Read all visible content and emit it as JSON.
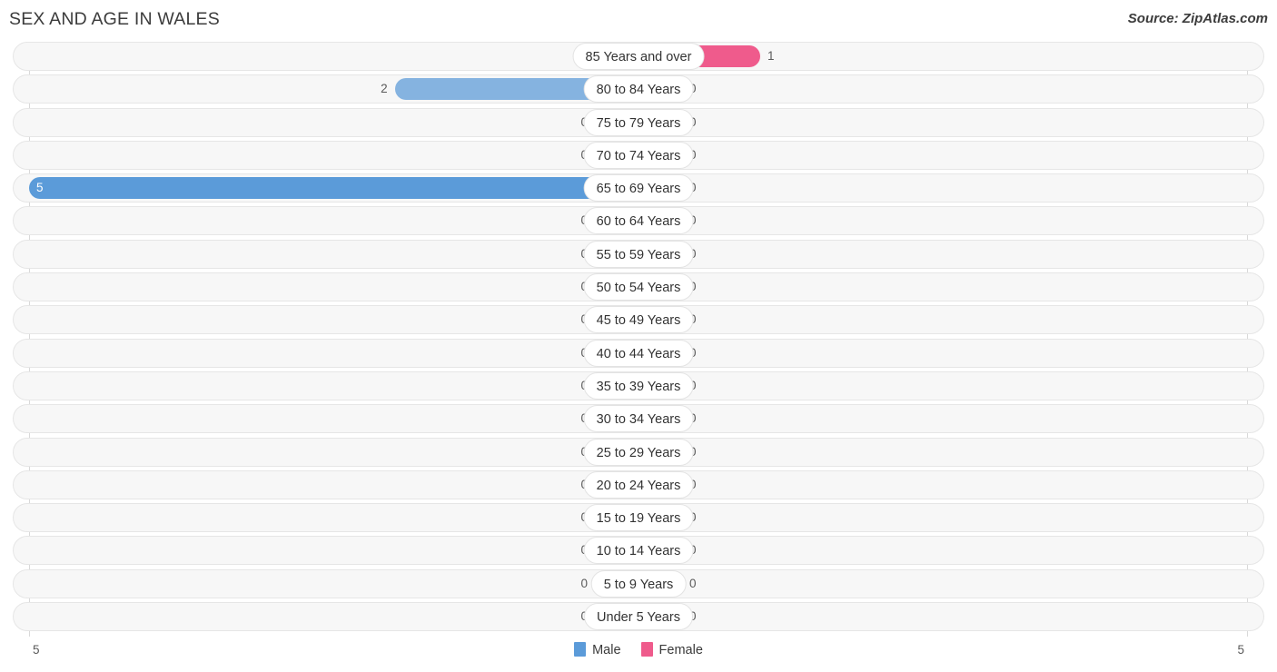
{
  "header": {
    "title": "SEX AND AGE IN WALES",
    "source": "Source: ZipAtlas.com"
  },
  "axis": {
    "left_end": "5",
    "right_end": "5",
    "max": 5
  },
  "legend": {
    "items": [
      {
        "label": "Male",
        "color": "#5b9bd9"
      },
      {
        "label": "Female",
        "color": "#ef5b8c"
      }
    ]
  },
  "colors": {
    "male_strong": "#5b9bd9",
    "male_mid": "#85b3e0",
    "male_light": "#aac8ec",
    "female_strong": "#ef5b8c",
    "female_light": "#f6a3bf",
    "track_fill": "#f7f7f7",
    "track_border": "#e6e6e6",
    "axis_line": "#d9d9d9"
  },
  "chart_data": {
    "type": "bar",
    "subtype": "diverging-population-pyramid",
    "title": "SEX AND AGE IN WALES",
    "xlabel": "",
    "ylabel": "",
    "xlim": [
      0,
      5
    ],
    "grid": false,
    "legend_position": "bottom-center",
    "categories": [
      "85 Years and over",
      "80 to 84 Years",
      "75 to 79 Years",
      "70 to 74 Years",
      "65 to 69 Years",
      "60 to 64 Years",
      "55 to 59 Years",
      "50 to 54 Years",
      "45 to 49 Years",
      "40 to 44 Years",
      "35 to 39 Years",
      "30 to 34 Years",
      "25 to 29 Years",
      "20 to 24 Years",
      "15 to 19 Years",
      "10 to 14 Years",
      "5 to 9 Years",
      "Under 5 Years"
    ],
    "series": [
      {
        "name": "Male",
        "color": "#5b9bd9",
        "values": [
          0,
          2,
          0,
          0,
          5,
          0,
          0,
          0,
          0,
          0,
          0,
          0,
          0,
          0,
          0,
          0,
          0,
          0
        ]
      },
      {
        "name": "Female",
        "color": "#ef5b8c",
        "values": [
          1,
          0,
          0,
          0,
          0,
          0,
          0,
          0,
          0,
          0,
          0,
          0,
          0,
          0,
          0,
          0,
          0,
          0
        ]
      }
    ],
    "rows": [
      {
        "label": "85 Years and over",
        "male": "0",
        "female": "1"
      },
      {
        "label": "80 to 84 Years",
        "male": "2",
        "female": "0"
      },
      {
        "label": "75 to 79 Years",
        "male": "0",
        "female": "0"
      },
      {
        "label": "70 to 74 Years",
        "male": "0",
        "female": "0"
      },
      {
        "label": "65 to 69 Years",
        "male": "5",
        "female": "0"
      },
      {
        "label": "60 to 64 Years",
        "male": "0",
        "female": "0"
      },
      {
        "label": "55 to 59 Years",
        "male": "0",
        "female": "0"
      },
      {
        "label": "50 to 54 Years",
        "male": "0",
        "female": "0"
      },
      {
        "label": "45 to 49 Years",
        "male": "0",
        "female": "0"
      },
      {
        "label": "40 to 44 Years",
        "male": "0",
        "female": "0"
      },
      {
        "label": "35 to 39 Years",
        "male": "0",
        "female": "0"
      },
      {
        "label": "30 to 34 Years",
        "male": "0",
        "female": "0"
      },
      {
        "label": "25 to 29 Years",
        "male": "0",
        "female": "0"
      },
      {
        "label": "20 to 24 Years",
        "male": "0",
        "female": "0"
      },
      {
        "label": "15 to 19 Years",
        "male": "0",
        "female": "0"
      },
      {
        "label": "10 to 14 Years",
        "male": "0",
        "female": "0"
      },
      {
        "label": "5 to 9 Years",
        "male": "0",
        "female": "0"
      },
      {
        "label": "Under 5 Years",
        "male": "0",
        "female": "0"
      }
    ]
  }
}
